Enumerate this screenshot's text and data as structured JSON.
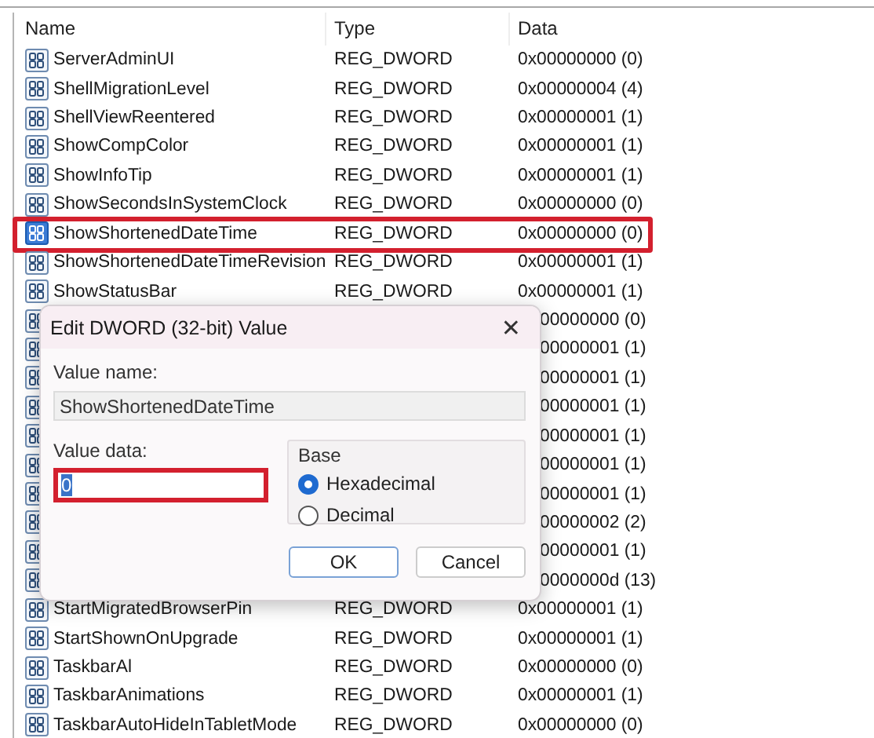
{
  "table": {
    "columns": [
      "Name",
      "Type",
      "Data"
    ],
    "rows": [
      {
        "kind": "full",
        "name": "ServerAdminUI",
        "type": "REG_DWORD",
        "data": "0x00000000 (0)",
        "selected": false,
        "annotated": false
      },
      {
        "kind": "full",
        "name": "ShellMigrationLevel",
        "type": "REG_DWORD",
        "data": "0x00000004 (4)",
        "selected": false,
        "annotated": false
      },
      {
        "kind": "full",
        "name": "ShellViewReentered",
        "type": "REG_DWORD",
        "data": "0x00000001 (1)",
        "selected": false,
        "annotated": false
      },
      {
        "kind": "full",
        "name": "ShowCompColor",
        "type": "REG_DWORD",
        "data": "0x00000001 (1)",
        "selected": false,
        "annotated": false
      },
      {
        "kind": "full",
        "name": "ShowInfoTip",
        "type": "REG_DWORD",
        "data": "0x00000001 (1)",
        "selected": false,
        "annotated": false
      },
      {
        "kind": "full",
        "name": "ShowSecondsInSystemClock",
        "type": "REG_DWORD",
        "data": "0x00000000 (0)",
        "selected": false,
        "annotated": false
      },
      {
        "kind": "full",
        "name": "ShowShortenedDateTime",
        "type": "REG_DWORD",
        "data": "0x00000000 (0)",
        "selected": true,
        "annotated": true
      },
      {
        "kind": "full",
        "name": "ShowShortenedDateTimeRevision",
        "type": "REG_DWORD",
        "data": "0x00000001 (1)",
        "selected": false,
        "annotated": false
      },
      {
        "kind": "full",
        "name": "ShowStatusBar",
        "type": "REG_DWORD",
        "data": "0x00000001 (1)",
        "selected": false,
        "annotated": false
      },
      {
        "kind": "covered",
        "data": "00000000 (0)"
      },
      {
        "kind": "covered",
        "data": "00000001 (1)"
      },
      {
        "kind": "covered",
        "data": "00000001 (1)"
      },
      {
        "kind": "covered",
        "data": "00000001 (1)"
      },
      {
        "kind": "covered",
        "data": "00000001 (1)"
      },
      {
        "kind": "covered",
        "data": "00000001 (1)"
      },
      {
        "kind": "covered",
        "data": "00000001 (1)"
      },
      {
        "kind": "covered",
        "data": "00000002 (2)"
      },
      {
        "kind": "covered",
        "data": "00000001 (1)"
      },
      {
        "kind": "covered",
        "data": "0000000d (13)"
      },
      {
        "kind": "full",
        "name": "StartMigratedBrowserPin",
        "type": "REG_DWORD",
        "data": "0x00000001 (1)",
        "selected": false,
        "annotated": false
      },
      {
        "kind": "full",
        "name": "StartShownOnUpgrade",
        "type": "REG_DWORD",
        "data": "0x00000001 (1)",
        "selected": false,
        "annotated": false
      },
      {
        "kind": "full",
        "name": "TaskbarAl",
        "type": "REG_DWORD",
        "data": "0x00000000 (0)",
        "selected": false,
        "annotated": false
      },
      {
        "kind": "full",
        "name": "TaskbarAnimations",
        "type": "REG_DWORD",
        "data": "0x00000001 (1)",
        "selected": false,
        "annotated": false
      },
      {
        "kind": "full",
        "name": "TaskbarAutoHideInTabletMode",
        "type": "REG_DWORD",
        "data": "0x00000000 (0)",
        "selected": false,
        "annotated": false
      }
    ]
  },
  "dialog": {
    "title": "Edit DWORD (32-bit) Value",
    "close": "✕",
    "value_name": {
      "label": "Value name:",
      "value": "ShowShortenedDateTime"
    },
    "value_data": {
      "label": "Value data:",
      "value": "0",
      "annotated": true
    },
    "base": {
      "label": "Base",
      "options": [
        {
          "label": "Hexadecimal",
          "selected": true
        },
        {
          "label": "Decimal",
          "selected": false
        }
      ]
    },
    "buttons": [
      "OK",
      "Cancel"
    ]
  }
}
